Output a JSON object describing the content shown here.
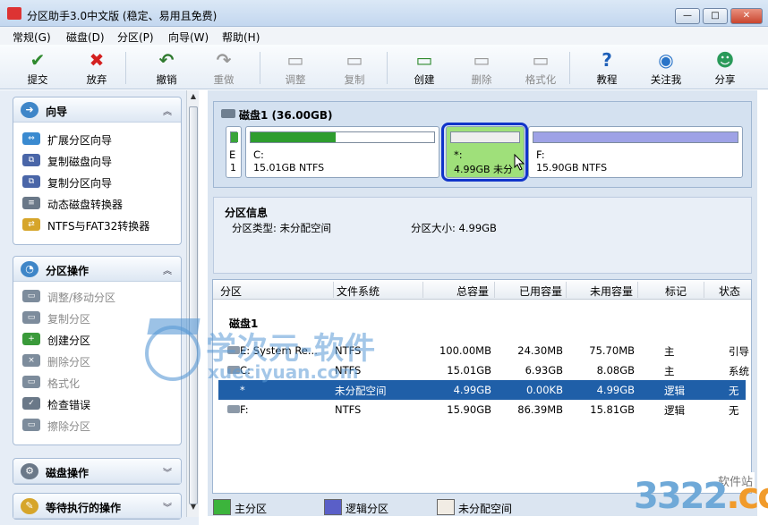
{
  "window": {
    "title": "分区助手3.0中文版 (稳定、易用且免费)",
    "min": "—",
    "max": "□",
    "close": "✕"
  },
  "menu": [
    "常规(G)",
    "磁盘(D)",
    "分区(P)",
    "向导(W)",
    "帮助(H)"
  ],
  "toolbar": [
    {
      "label": "提交",
      "icon": "✔",
      "color": "#2f8a2f",
      "disabled": false
    },
    {
      "label": "放弃",
      "icon": "✖",
      "color": "#d42020",
      "disabled": false
    },
    {
      "label": "撤销",
      "icon": "↶",
      "color": "#2f7a2f",
      "disabled": false
    },
    {
      "label": "重做",
      "icon": "↷",
      "color": "#999999",
      "disabled": true
    },
    {
      "label": "调整",
      "icon": "▭",
      "color": "#999999",
      "disabled": true
    },
    {
      "label": "复制",
      "icon": "▭",
      "color": "#999999",
      "disabled": true
    },
    {
      "label": "创建",
      "icon": "▭",
      "color": "#2f8a2f",
      "disabled": false
    },
    {
      "label": "删除",
      "icon": "▭",
      "color": "#999999",
      "disabled": true
    },
    {
      "label": "格式化",
      "icon": "▭",
      "color": "#999999",
      "disabled": true
    },
    {
      "label": "教程",
      "icon": "?",
      "color": "#1e5fb8",
      "disabled": false
    },
    {
      "label": "关注我",
      "icon": "◉",
      "color": "#2a74c8",
      "disabled": false
    },
    {
      "label": "分享",
      "icon": "☻",
      "color": "#2a9a5a",
      "disabled": false
    }
  ],
  "wizard_panel": {
    "title": "向导",
    "items": [
      "扩展分区向导",
      "复制磁盘向导",
      "复制分区向导",
      "动态磁盘转换器",
      "NTFS与FAT32转换器"
    ]
  },
  "partition_ops_panel": {
    "title": "分区操作",
    "items": [
      {
        "label": "调整/移动分区",
        "disabled": true
      },
      {
        "label": "复制分区",
        "disabled": true
      },
      {
        "label": "创建分区",
        "disabled": false
      },
      {
        "label": "删除分区",
        "disabled": true
      },
      {
        "label": "格式化",
        "disabled": true
      },
      {
        "label": "检查错误",
        "disabled": false
      },
      {
        "label": "擦除分区",
        "disabled": true
      }
    ]
  },
  "disk_ops_panel": {
    "title": "磁盘操作"
  },
  "pending_panel": {
    "title": "等待执行的操作"
  },
  "disk_map": {
    "title": "磁盘1 (36.00GB)",
    "partitions": [
      {
        "name": "E",
        "sub": "1",
        "size": "",
        "used_fraction": 1.0,
        "bar_color": "#3aa53a"
      },
      {
        "name": "C:",
        "size": "15.01GB NTFS",
        "used_fraction": 0.46,
        "bar_color": "#2e9d2e"
      },
      {
        "name": "*:",
        "size": "4.99GB 未分",
        "used_fraction": 0.0,
        "bar_color": "#e6e6e6"
      },
      {
        "name": "F:",
        "size": "15.90GB NTFS",
        "used_fraction": 0.0,
        "bar_color": "#8b8fd6"
      }
    ]
  },
  "partition_info": {
    "title": "分区信息",
    "type_label": "分区类型: 未分配空间",
    "size_label": "分区大小: 4.99GB"
  },
  "table": {
    "headers": [
      "分区",
      "文件系统",
      "总容量",
      "已用容量",
      "未用容量",
      "标记",
      "状态"
    ],
    "group": "磁盘1",
    "rows": [
      {
        "name": "E: System Re...",
        "fs": "NTFS",
        "total": "100.00MB",
        "used": "24.30MB",
        "free": "75.70MB",
        "flag": "主",
        "state": "引导",
        "selected": false
      },
      {
        "name": "C:",
        "fs": "NTFS",
        "total": "15.01GB",
        "used": "6.93GB",
        "free": "8.08GB",
        "flag": "主",
        "state": "系统",
        "selected": false
      },
      {
        "name": "*",
        "fs": "未分配空间",
        "total": "4.99GB",
        "used": "0.00KB",
        "free": "4.99GB",
        "flag": "逻辑",
        "state": "无",
        "selected": true
      },
      {
        "name": "F:",
        "fs": "NTFS",
        "total": "15.90GB",
        "used": "86.39MB",
        "free": "15.81GB",
        "flag": "逻辑",
        "state": "无",
        "selected": false
      }
    ]
  },
  "legend": [
    {
      "label": "主分区",
      "color": "#3cb43c"
    },
    {
      "label": "逻辑分区",
      "color": "#5a5fc8"
    },
    {
      "label": "未分配空间",
      "color": "#f1ece4"
    }
  ],
  "watermark": {
    "cn": "学次元-软件",
    "url": "xueciyuan.com",
    "brand_main": "3322",
    "brand_dot": ".cc",
    "brand_tag": "软件站"
  }
}
